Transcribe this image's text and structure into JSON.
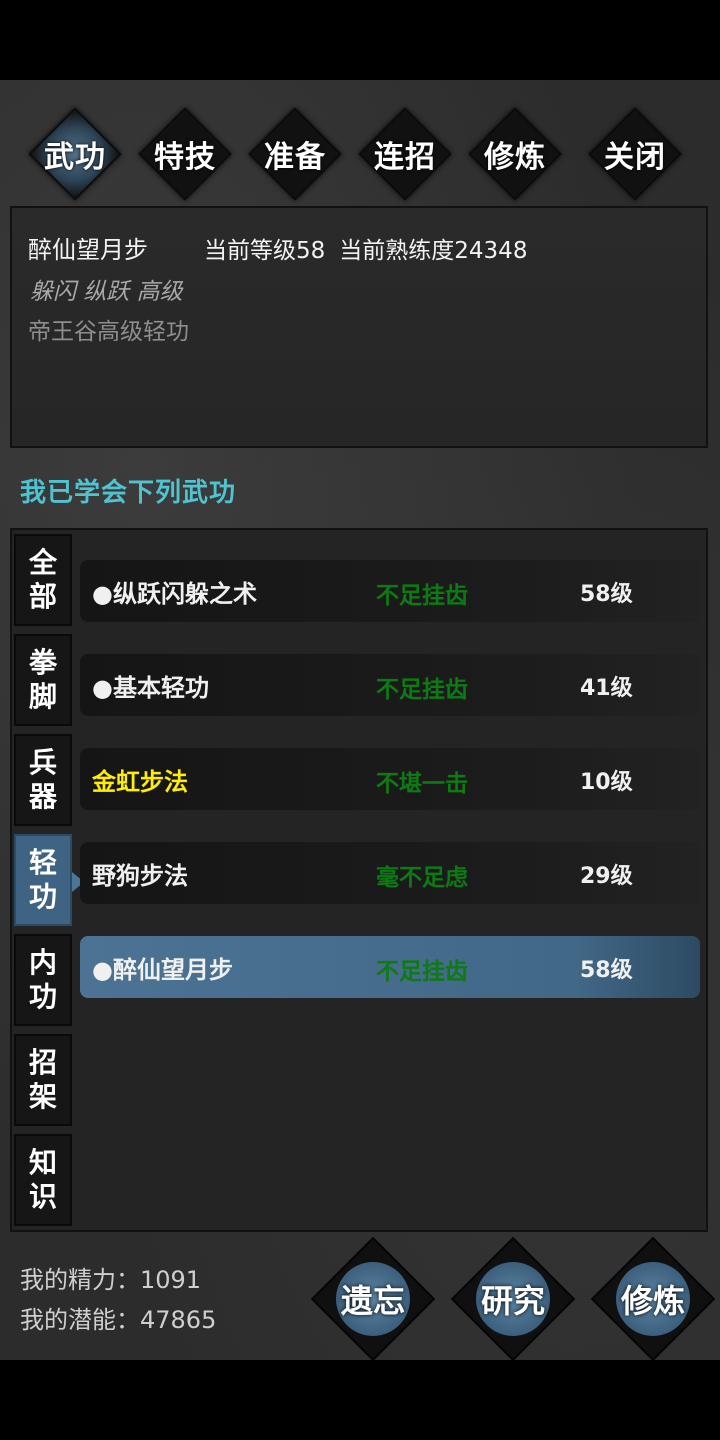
{
  "tabs": [
    {
      "label": "武功",
      "active": true
    },
    {
      "label": "特技",
      "active": false
    },
    {
      "label": "准备",
      "active": false
    },
    {
      "label": "连招",
      "active": false
    },
    {
      "label": "修炼",
      "active": false
    },
    {
      "label": "关闭",
      "active": false
    }
  ],
  "info": {
    "name": "醉仙望月步",
    "level_text": "当前等级58",
    "proficiency_text": "当前熟练度24348",
    "tags": "躲闪 纵跃 高级",
    "description": "帝王谷高级轻功"
  },
  "section_title": "我已学会下列武功",
  "categories": [
    {
      "label": "全部",
      "active": false
    },
    {
      "label": "拳脚",
      "active": false
    },
    {
      "label": "兵器",
      "active": false
    },
    {
      "label": "轻功",
      "active": true
    },
    {
      "label": "内功",
      "active": false
    },
    {
      "label": "招架",
      "active": false
    },
    {
      "label": "知识",
      "active": false
    }
  ],
  "skills": [
    {
      "name": "●纵跃闪躲之术",
      "eval": "不足挂齿",
      "level": "58级",
      "highlight": false,
      "selected": false
    },
    {
      "name": "●基本轻功",
      "eval": "不足挂齿",
      "level": "41级",
      "highlight": false,
      "selected": false
    },
    {
      "name": "金虹步法",
      "eval": "不堪一击",
      "level": "10级",
      "highlight": true,
      "selected": false
    },
    {
      "name": "野狗步法",
      "eval": "毫不足虑",
      "level": "29级",
      "highlight": false,
      "selected": false
    },
    {
      "name": "●醉仙望月步",
      "eval": "不足挂齿",
      "level": "58级",
      "highlight": false,
      "selected": true
    }
  ],
  "stats": {
    "energy_label": "我的精力：",
    "energy_value": "1091",
    "potential_label": "我的潜能：",
    "potential_value": "47865"
  },
  "buttons": {
    "forget": "遗忘",
    "research": "研究",
    "practice": "修炼"
  },
  "colors": {
    "accent_blue": "#416887",
    "eval_green": "#0e7a14",
    "highlight_gold": "#ffee00",
    "title_cyan": "#4fc3cf"
  }
}
